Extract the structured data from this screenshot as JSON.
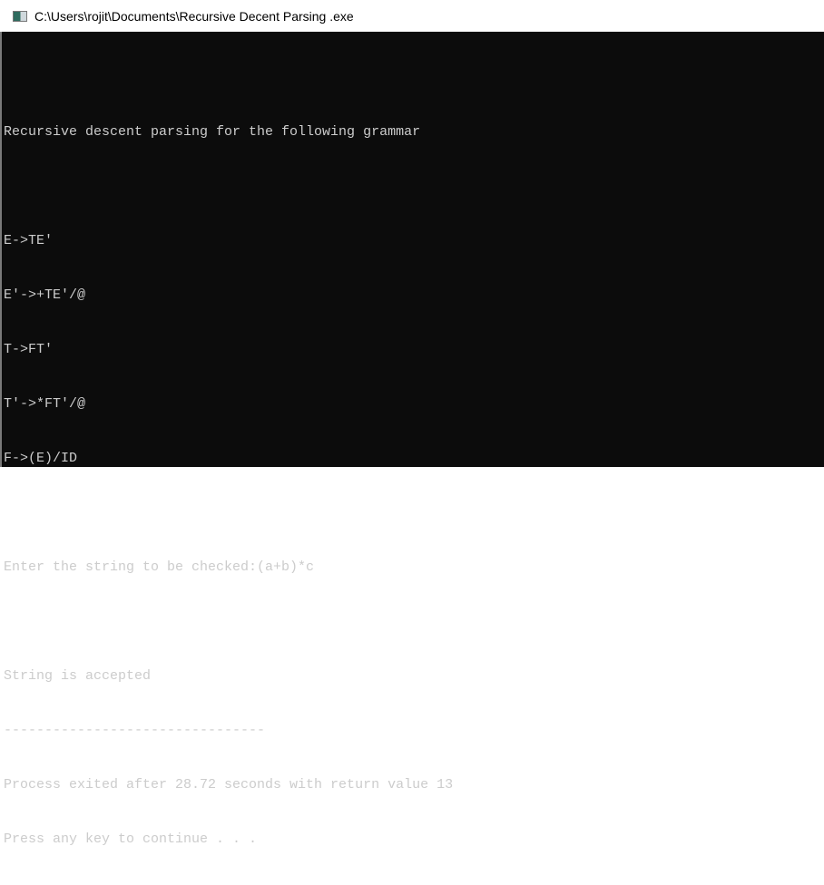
{
  "window": {
    "title": "C:\\Users\\rojit\\Documents\\Recursive Decent Parsing .exe",
    "icon": "console-app-icon"
  },
  "console": {
    "lines": [
      "",
      "Recursive descent parsing for the following grammar",
      "",
      "E->TE'",
      "E'->+TE'/@",
      "T->FT'",
      "T'->*FT'/@",
      "F->(E)/ID",
      "",
      "Enter the string to be checked:(a+b)*c",
      "",
      "String is accepted",
      "--------------------------------",
      "Process exited after 28.72 seconds with return value 13",
      "Press any key to continue . . ."
    ]
  }
}
